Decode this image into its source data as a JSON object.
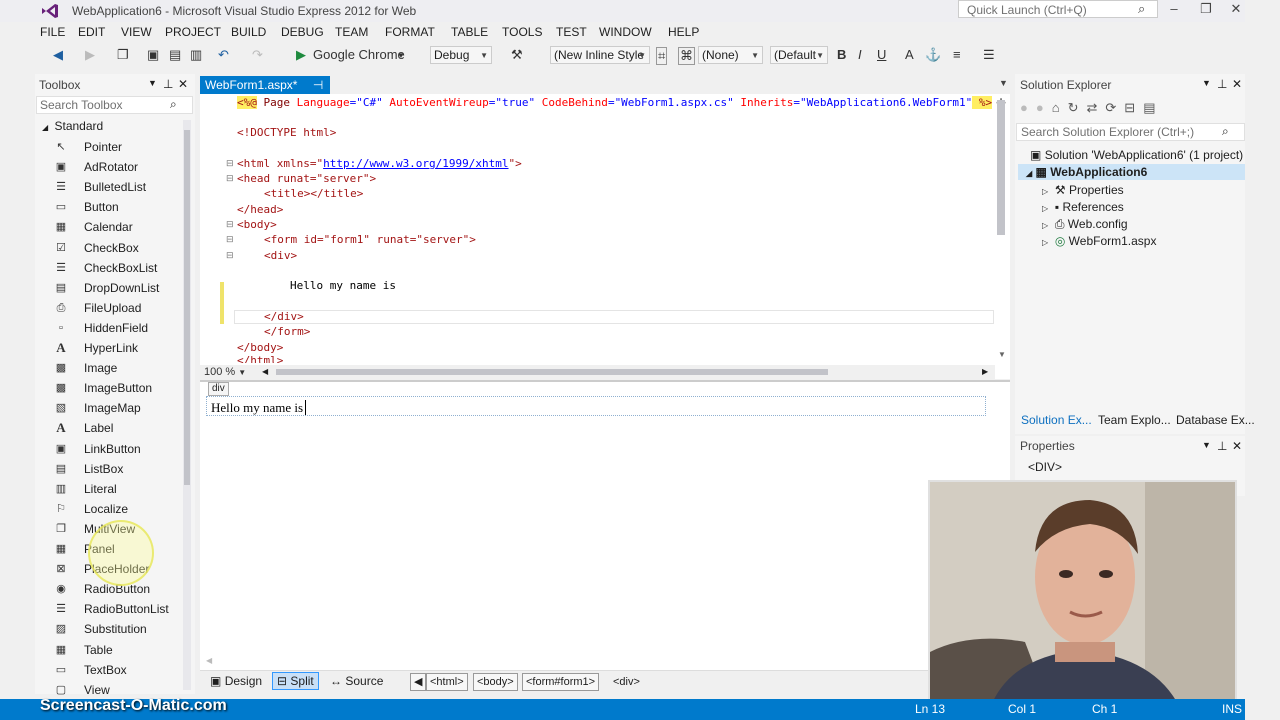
{
  "window": {
    "title": "WebApplication6 - Microsoft Visual Studio Express 2012 for Web",
    "quick_launch_placeholder": "Quick Launch (Ctrl+Q)"
  },
  "menu": [
    "FILE",
    "EDIT",
    "VIEW",
    "PROJECT",
    "BUILD",
    "DEBUG",
    "TEAM",
    "FORMAT",
    "TABLE",
    "TOOLS",
    "TEST",
    "WINDOW",
    "HELP"
  ],
  "toolbar": {
    "browser": "Google Chrome",
    "config": "Debug",
    "style_combo": "(New Inline Style",
    "target_combo": "(None)",
    "font_combo": "(Default",
    "bold": "B",
    "italic": "I",
    "underline": "U"
  },
  "toolbox": {
    "title": "Toolbox",
    "search_placeholder": "Search Toolbox",
    "section": "Standard",
    "items": [
      {
        "label": "Pointer",
        "icon": "pointer-icon"
      },
      {
        "label": "AdRotator",
        "icon": "adrotator-icon"
      },
      {
        "label": "BulletedList",
        "icon": "bulletedlist-icon"
      },
      {
        "label": "Button",
        "icon": "button-icon"
      },
      {
        "label": "Calendar",
        "icon": "calendar-icon"
      },
      {
        "label": "CheckBox",
        "icon": "checkbox-icon"
      },
      {
        "label": "CheckBoxList",
        "icon": "checkboxlist-icon"
      },
      {
        "label": "DropDownList",
        "icon": "dropdownlist-icon"
      },
      {
        "label": "FileUpload",
        "icon": "fileupload-icon"
      },
      {
        "label": "HiddenField",
        "icon": "hiddenfield-icon"
      },
      {
        "label": "HyperLink",
        "icon": "hyperlink-icon"
      },
      {
        "label": "Image",
        "icon": "image-icon"
      },
      {
        "label": "ImageButton",
        "icon": "imagebutton-icon"
      },
      {
        "label": "ImageMap",
        "icon": "imagemap-icon"
      },
      {
        "label": "Label",
        "icon": "label-icon"
      },
      {
        "label": "LinkButton",
        "icon": "linkbutton-icon"
      },
      {
        "label": "ListBox",
        "icon": "listbox-icon"
      },
      {
        "label": "Literal",
        "icon": "literal-icon"
      },
      {
        "label": "Localize",
        "icon": "localize-icon"
      },
      {
        "label": "MultiView",
        "icon": "multiview-icon"
      },
      {
        "label": "Panel",
        "icon": "panel-icon"
      },
      {
        "label": "PlaceHolder",
        "icon": "placeholder-icon"
      },
      {
        "label": "RadioButton",
        "icon": "radiobutton-icon"
      },
      {
        "label": "RadioButtonList",
        "icon": "radiobuttonlist-icon"
      },
      {
        "label": "Substitution",
        "icon": "substitution-icon"
      },
      {
        "label": "Table",
        "icon": "table-icon"
      },
      {
        "label": "TextBox",
        "icon": "textbox-icon"
      },
      {
        "label": "View",
        "icon": "view-icon"
      }
    ]
  },
  "editor": {
    "tab": "WebForm1.aspx*",
    "zoom": "100 %",
    "lines": {
      "l1_open": "<%@",
      "l1_page": " Page ",
      "l1_a1": "Language",
      "l1_v1": "\"C#\"",
      "l1_a2": "AutoEventWireup",
      "l1_v2": "\"true\"",
      "l1_a3": "CodeBehind",
      "l1_v3": "\"WebForm1.aspx.cs\"",
      "l1_a4": "Inherits",
      "l1_v4": "\"WebApplication6.WebForm1\"",
      "l1_close": " %>",
      "doctype": "<!DOCTYPE html>",
      "html_open": "<html xmlns=\"",
      "html_url": "http://www.w3.org/1999/xhtml",
      "html_close": "\">",
      "head_open": "<head runat=\"server\">",
      "title": "<title></title>",
      "head_close": "</head>",
      "body_open": "<body>",
      "form_open": "<form id=\"form1\" runat=\"server\">",
      "div_open": "<div>",
      "text": "Hello my name is",
      "div_close": "</div>",
      "form_close": "</form>",
      "body_close": "</body>",
      "html_end": "</html>"
    }
  },
  "design": {
    "tag_label": "div",
    "text": "Hello my name is"
  },
  "bottom": {
    "design": "Design",
    "split": "Split",
    "source": "Source",
    "crumbs": [
      "<html>",
      "<body>",
      "<form#form1>",
      "<div>"
    ]
  },
  "solution_explorer": {
    "title": "Solution Explorer",
    "search_placeholder": "Search Solution Explorer (Ctrl+;)",
    "solution": "Solution 'WebApplication6' (1 project)",
    "project": "WebApplication6",
    "items": [
      "Properties",
      "References",
      "Web.config",
      "WebForm1.aspx"
    ],
    "tabs": [
      "Solution Ex...",
      "Team Explo...",
      "Database Ex..."
    ]
  },
  "properties": {
    "title": "Properties",
    "selected": "<DIV>"
  },
  "status": {
    "ln": "Ln 13",
    "col": "Col 1",
    "ch": "Ch 1",
    "ins": "INS"
  },
  "watermark": "Screencast-O-Matic.com"
}
